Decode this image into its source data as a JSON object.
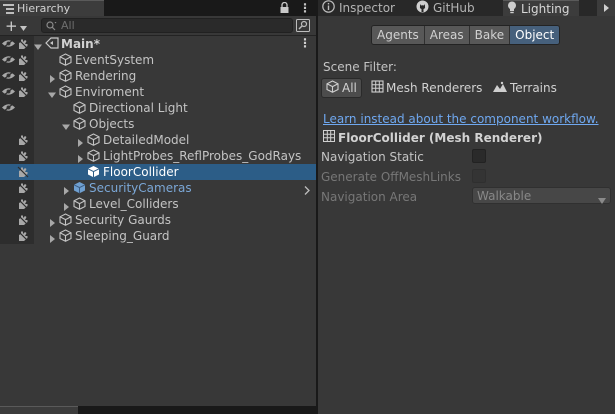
{
  "hierarchy": {
    "tab_label": "Hierarchy",
    "add_label": "+",
    "search_placeholder": "All",
    "rows": [
      {
        "label": "Main*",
        "depth": 0,
        "foldable": "open",
        "icon": "scene-icon",
        "bold": true,
        "eye": true,
        "hand": true
      },
      {
        "label": "EventSystem",
        "depth": 1,
        "foldable": "none",
        "icon": "gameobject-icon",
        "eye": true,
        "hand": true
      },
      {
        "label": "Rendering",
        "depth": 1,
        "foldable": "closed",
        "icon": "gameobject-icon",
        "eye": true,
        "hand": true
      },
      {
        "label": "Enviroment",
        "depth": 1,
        "foldable": "open",
        "icon": "gameobject-icon",
        "eye": true,
        "hand": true
      },
      {
        "label": "Directional Light",
        "depth": 2,
        "foldable": "none",
        "icon": "gameobject-icon",
        "eye": true,
        "hand": false
      },
      {
        "label": "Objects",
        "depth": 2,
        "foldable": "open",
        "icon": "gameobject-icon",
        "eye": false,
        "hand": false
      },
      {
        "label": "DetailedModel",
        "depth": 3,
        "foldable": "closed",
        "icon": "gameobject-icon",
        "eye": false,
        "hand": true
      },
      {
        "label": "LightProbes_ReflProbes_GodRays",
        "depth": 3,
        "foldable": "closed",
        "icon": "gameobject-icon",
        "eye": false,
        "hand": true
      },
      {
        "label": "FloorCollider",
        "depth": 3,
        "foldable": "none",
        "icon": "gameobject-icon",
        "selected": true,
        "eye": false,
        "hand": true
      },
      {
        "label": "SecurityCameras",
        "depth": 2,
        "foldable": "closed",
        "icon": "prefab-icon",
        "blue": true,
        "chevron": true,
        "eye": false,
        "hand": true
      },
      {
        "label": "Level_Colliders",
        "depth": 2,
        "foldable": "closed",
        "icon": "gameobject-icon",
        "eye": false,
        "hand": true
      },
      {
        "label": "Security Gaurds",
        "depth": 1,
        "foldable": "closed",
        "icon": "gameobject-icon",
        "eye": false,
        "hand": true
      },
      {
        "label": "Sleeping_Guard",
        "depth": 1,
        "foldable": "closed",
        "icon": "gameobject-icon",
        "eye": false,
        "hand": true
      }
    ]
  },
  "right_tabs": [
    {
      "label": "Inspector",
      "icon": "info-icon",
      "active": false
    },
    {
      "label": "GitHub",
      "icon": "github-icon",
      "active": false
    },
    {
      "label": "Lighting",
      "icon": "lightbulb-icon",
      "active": true
    }
  ],
  "nav": {
    "segments": [
      "Agents",
      "Areas",
      "Bake",
      "Object"
    ],
    "active_segment": "Object",
    "scene_filter_label": "Scene Filter:",
    "filters": [
      {
        "label": "All",
        "icon": "cube-icon",
        "active": true
      },
      {
        "label": "Mesh Renderers",
        "icon": "grid-icon",
        "active": false
      },
      {
        "label": "Terrains",
        "icon": "terrain-icon",
        "active": false
      }
    ],
    "workflow_link": "Learn instead about the component workflow.",
    "component_title": "FloorCollider (Mesh Renderer)",
    "navigation_static_label": "Navigation Static",
    "generate_links_label": "Generate OffMeshLinks",
    "navigation_area_label": "Navigation Area",
    "navigation_area_value": "Walkable"
  },
  "colors": {
    "selection": "#2c5d87",
    "link": "#6fa8f0",
    "prefab_text": "#7ba7d6"
  }
}
